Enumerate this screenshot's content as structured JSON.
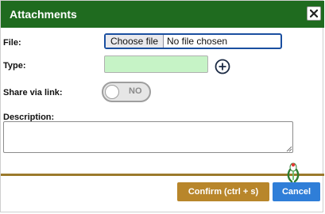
{
  "dialog": {
    "title": "Attachments",
    "close_icon": "close-icon"
  },
  "form": {
    "file_label": "File:",
    "choose_file_label": "Choose file",
    "file_status": "No file chosen",
    "type_label": "Type:",
    "type_value": "",
    "add_type_icon": "plus-circle-icon",
    "share_label": "Share via link:",
    "share_toggle_state": "NO",
    "description_label": "Description:",
    "description_value": ""
  },
  "footer": {
    "confirm_label": "Confirm (ctrl + s)",
    "cancel_label": "Cancel",
    "mascot_icon": "mascot-icon"
  },
  "colors": {
    "titlebar": "#1f6b1f",
    "type_field": "#c6f3c6",
    "divider": "#9b7a2c",
    "confirm": "#b8862b",
    "cancel": "#2f7ed8"
  }
}
